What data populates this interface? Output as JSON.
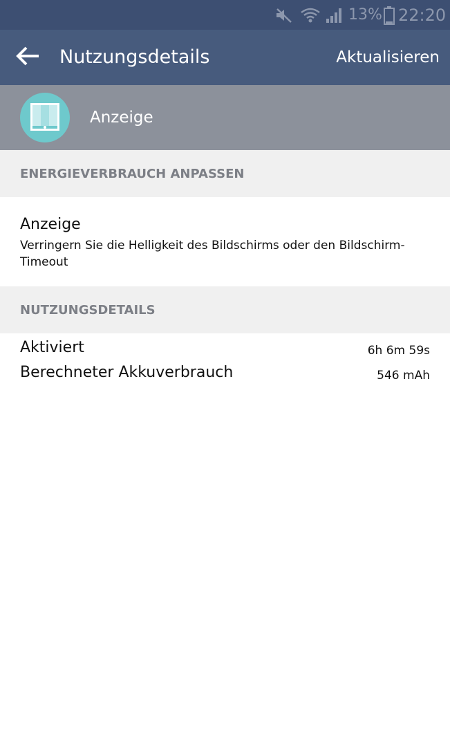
{
  "status_bar": {
    "battery_percent": "13%",
    "time": "22:20",
    "icons": [
      "mute-icon",
      "wifi-icon",
      "signal-icon",
      "battery-icon"
    ]
  },
  "app_bar": {
    "title": "Nutzungsdetails",
    "refresh_label": "Aktualisieren",
    "back_icon": "arrow-left-icon"
  },
  "app_header": {
    "name": "Anzeige",
    "icon": "display-icon"
  },
  "sections": {
    "energy_header": "ENERGIEVERBRAUCH ANPASSEN",
    "usage_header": "NUTZUNGSDETAILS"
  },
  "energy_item": {
    "title": "Anzeige",
    "description": "Verringern Sie die Helligkeit des Bildschirms oder den Bildschirm-Timeout"
  },
  "usage": [
    {
      "label": "Aktiviert",
      "value": "6h 6m 59s"
    },
    {
      "label": "Berechneter Akkuverbrauch",
      "value": "546 mAh"
    }
  ],
  "colors": {
    "status_bar": "#3d4f72",
    "app_bar": "#475b7d",
    "app_header": "#8c919b",
    "icon_accent": "#6ec9cc",
    "section_bg": "#f0f0f0"
  }
}
